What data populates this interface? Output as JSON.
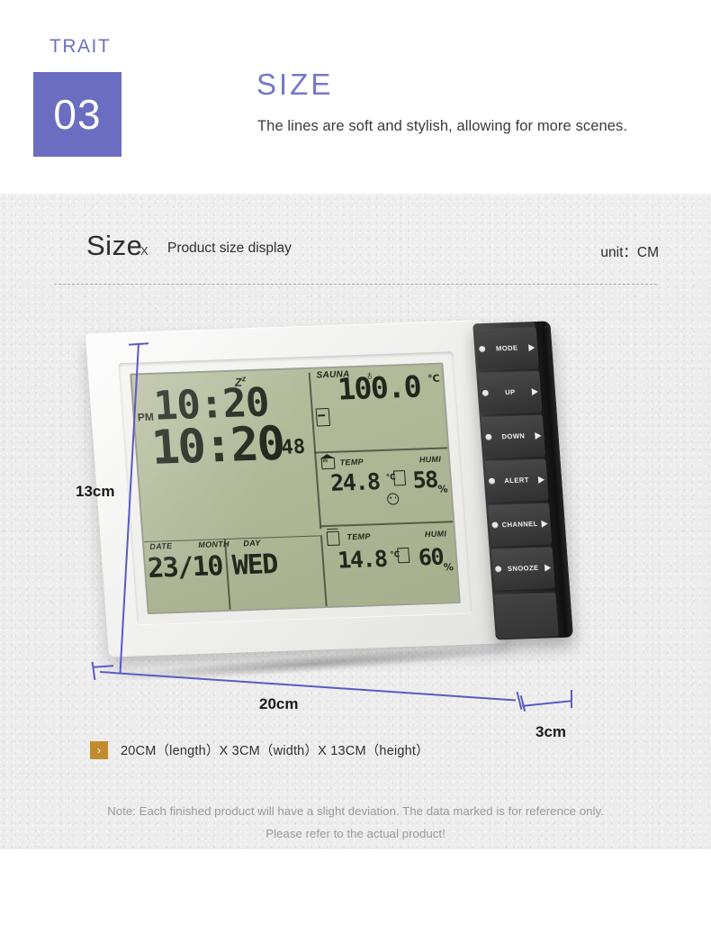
{
  "header": {
    "trait_label": "TRAIT",
    "trait_number": "03",
    "title": "SIZE",
    "subtitle": "The lines are soft and stylish, allowing for more scenes."
  },
  "size_section": {
    "heading": "Size",
    "separator": "X",
    "caption": "Product size display",
    "unit_text": "unit：CM"
  },
  "product": {
    "lcd": {
      "snooze_icon": "Z",
      "snooze_sup": "z",
      "bell_icon": "♁",
      "meridiem": "PM",
      "time_top": "10:20",
      "time_main": "10:20",
      "seconds": "48",
      "date_label": "DATE",
      "month_label": "MONTH",
      "day_label": "DAY",
      "date_value": "23/10",
      "day_value": "WED",
      "sauna_label": "SAUNA",
      "sauna_value": "100.0",
      "sauna_unit": "℃",
      "indoor_temp_label": "TEMP",
      "indoor_humi_label": "HUMI",
      "indoor_icon_text": "IN",
      "indoor_temp_value": "24.8",
      "indoor_temp_unit": "℃",
      "indoor_humi_value": "58",
      "indoor_humi_unit": "%",
      "outdoor_temp_label": "TEMP",
      "outdoor_humi_label": "HUMI",
      "outdoor_temp_value": "14.8",
      "outdoor_temp_unit": "℃",
      "outdoor_humi_value": "60",
      "outdoor_humi_unit": "%"
    },
    "buttons": [
      {
        "label": "MODE"
      },
      {
        "label": "UP"
      },
      {
        "label": "DOWN"
      },
      {
        "label": "ALERT"
      },
      {
        "label": "CHANNEL"
      },
      {
        "label": "SNOOZE"
      }
    ]
  },
  "dimensions": {
    "height_label": "13cm",
    "length_label": "20cm",
    "depth_label": "3cm",
    "line_color": "#5a5ac8"
  },
  "caption": {
    "marker": "›",
    "text": "20CM（length）X 3CM（width）X 13CM（height）"
  },
  "note": {
    "line1": "Note: Each finished product will have a slight deviation. The data marked is for reference only.",
    "line2": "Please refer to the actual product!"
  },
  "colors": {
    "accent_purple": "#6b6dc0",
    "marker_gold": "#c08b2e",
    "lcd_green": "#aeb796"
  }
}
